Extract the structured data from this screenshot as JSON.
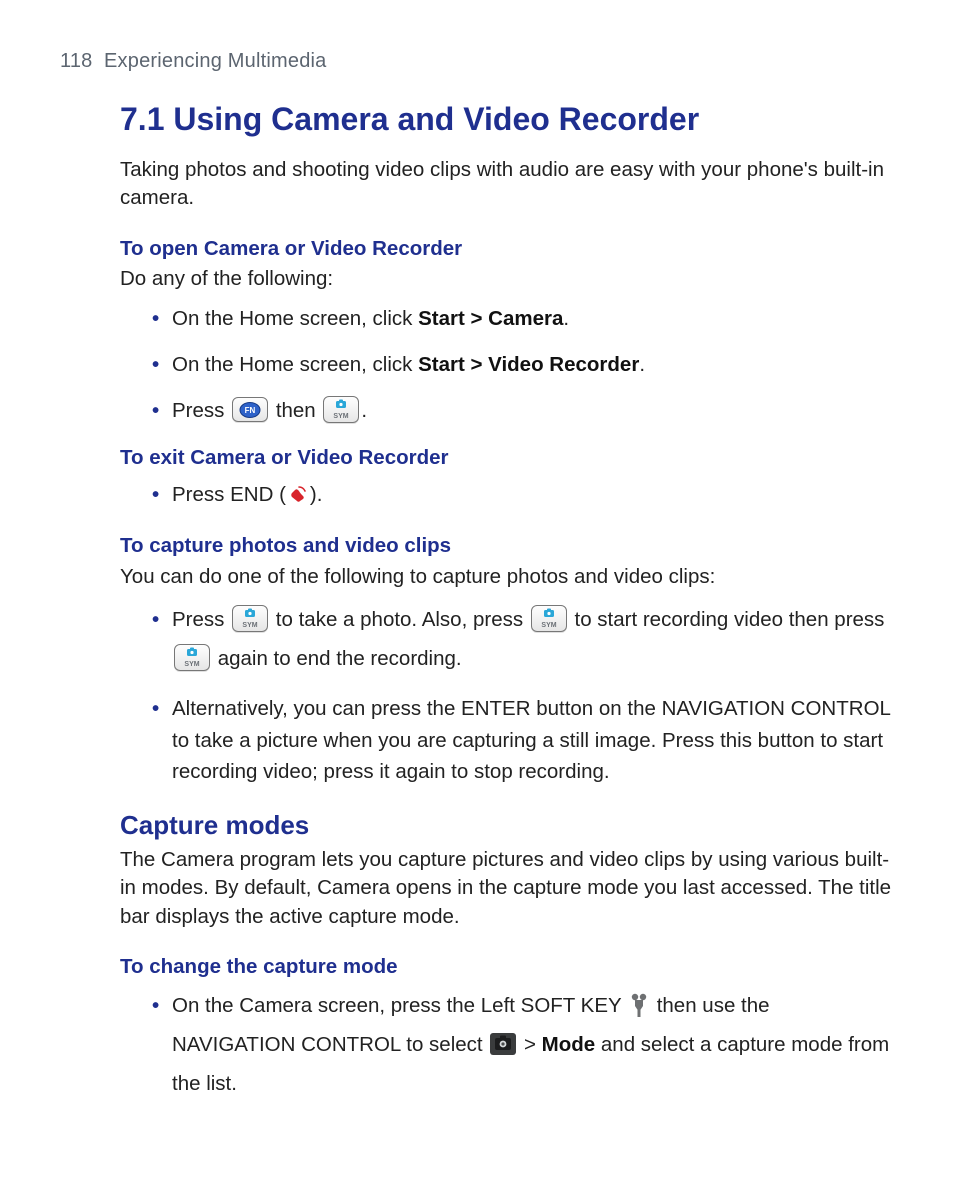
{
  "header": {
    "page_number": "118",
    "chapter": "Experiencing Multimedia"
  },
  "section": {
    "number": "7.1",
    "title": "Using Camera and Video Recorder",
    "intro": "Taking photos and shooting video clips with audio are easy with your phone's built-in camera."
  },
  "open": {
    "heading": "To open Camera or Video Recorder",
    "lead": "Do any of the following:",
    "items": [
      {
        "pre": "On the Home screen, click ",
        "bold": "Start > Camera",
        "post": "."
      },
      {
        "pre": "On the Home screen, click ",
        "bold": "Start > Video Recorder",
        "post": "."
      }
    ],
    "press_label": "Press ",
    "then_label": " then ",
    "period": "."
  },
  "exit": {
    "heading": "To exit Camera or Video Recorder",
    "press_end": "Press END (",
    "close_paren": ")."
  },
  "capture": {
    "heading": "To capture photos and video clips",
    "lead": "You can do one of the following to capture photos and video clips:",
    "item1_a": "Press ",
    "item1_b": " to take a photo. Also, press ",
    "item1_c": " to start recording video then press ",
    "item1_d": " again to end the recording.",
    "item2": "Alternatively, you can press the ENTER button on the NAVIGATION CONTROL to take a picture when you are capturing a still image. Press this button to start recording video; press it again to stop recording."
  },
  "modes": {
    "heading": "Capture modes",
    "para": "The Camera program lets you capture pictures and video clips by using various built-in modes. By default, Camera opens in the capture mode you last accessed. The title bar displays the active capture mode."
  },
  "change_mode": {
    "heading": "To change the capture mode",
    "a": "On the Camera screen, press the Left SOFT KEY ",
    "b": " then use the NAVIGATION CONTROL to select ",
    "gt": " > ",
    "mode_label": "Mode",
    "c": " and select a capture mode from the list."
  }
}
